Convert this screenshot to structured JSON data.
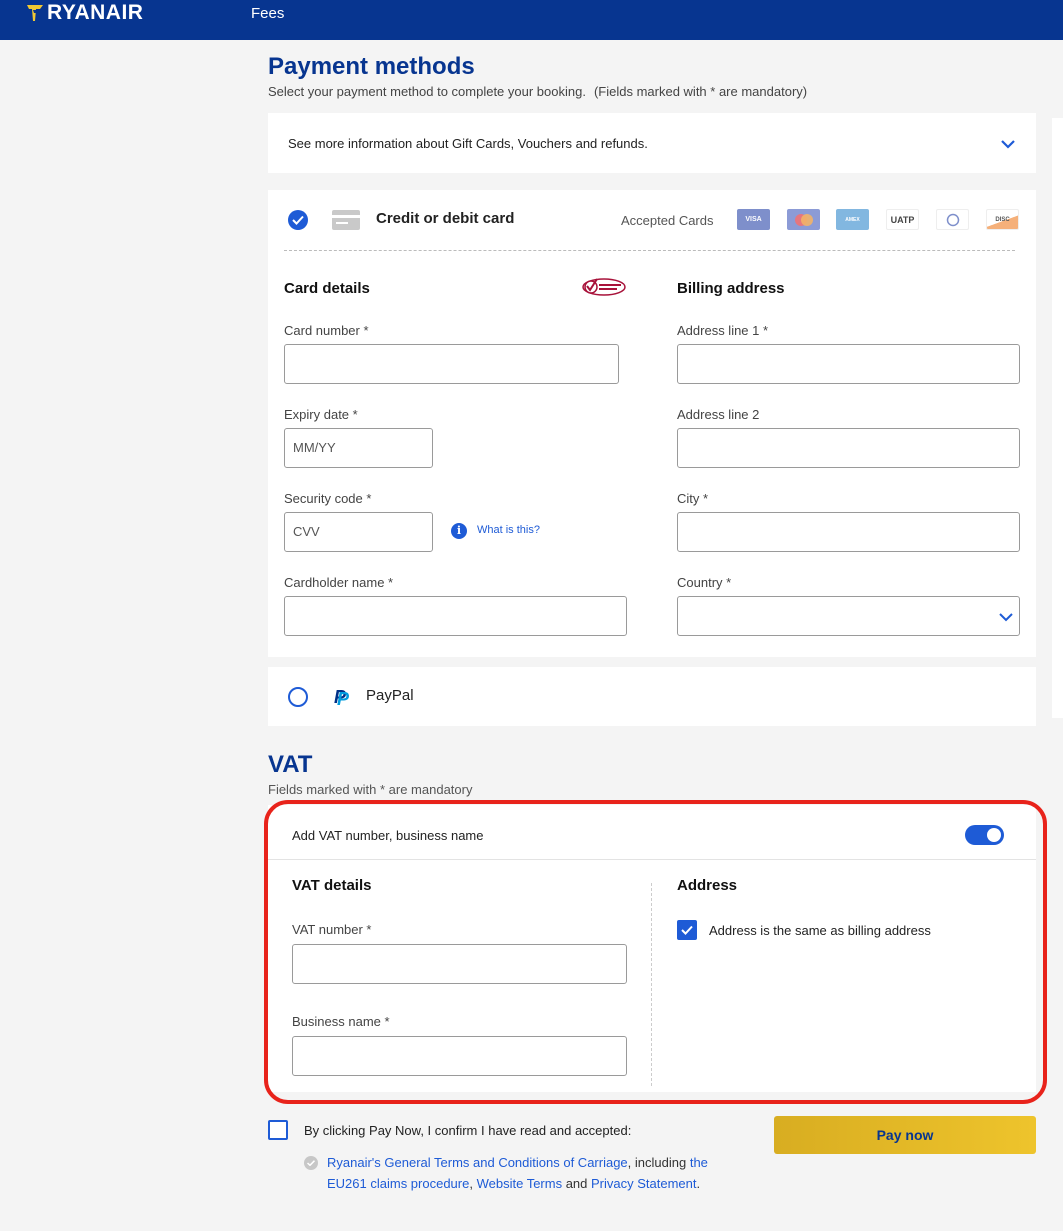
{
  "header": {
    "brand": "RYANAIR",
    "nav_fees": "Fees",
    "brand_color": "#073590"
  },
  "payment": {
    "title": "Payment methods",
    "subtitle": "Select your payment method to complete your booking.",
    "mandatory_note": "(Fields marked with * are mandatory)",
    "info_text": "See more information about Gift Cards, Vouchers and refunds.",
    "credit_card": {
      "title": "Credit or debit card",
      "selected": true,
      "accepted_label": "Accepted Cards",
      "card_logos": [
        "VISA",
        "Mastercard",
        "American Express",
        "UATP",
        "Diners Club",
        "Discover"
      ],
      "card_details_title": "Card details",
      "billing_title": "Billing address",
      "card_number_label": "Card number *",
      "expiry_label": "Expiry date *",
      "expiry_placeholder": "MM/YY",
      "security_label": "Security code *",
      "security_placeholder": "CVV",
      "what_is_this": "What is this?",
      "cardholder_label": "Cardholder name *",
      "address1_label": "Address line 1 *",
      "address2_label": "Address line 2",
      "city_label": "City *",
      "country_label": "Country *"
    },
    "paypal": {
      "label": "PayPal",
      "selected": false
    }
  },
  "vat": {
    "title": "VAT",
    "subtitle": "Fields marked with * are mandatory",
    "toggle_label": "Add VAT number, business name",
    "toggle_on": true,
    "details_title": "VAT details",
    "vat_number_label": "VAT number *",
    "business_name_label": "Business name *",
    "address_title": "Address",
    "same_address_label": "Address is the same as billing address",
    "same_address_checked": true
  },
  "terms": {
    "confirm_text": "By clicking Pay Now, I confirm I have read and accepted:",
    "link_general": "Ryanair's General Terms and Conditions of Carriage",
    "including": ", including ",
    "link_the": "the",
    "link_eu261": "EU261 claims procedure",
    "comma": ", ",
    "link_website": "Website Terms",
    "and": " and ",
    "link_privacy": "Privacy Statement",
    "period": "."
  },
  "pay_now_label": "Pay now"
}
